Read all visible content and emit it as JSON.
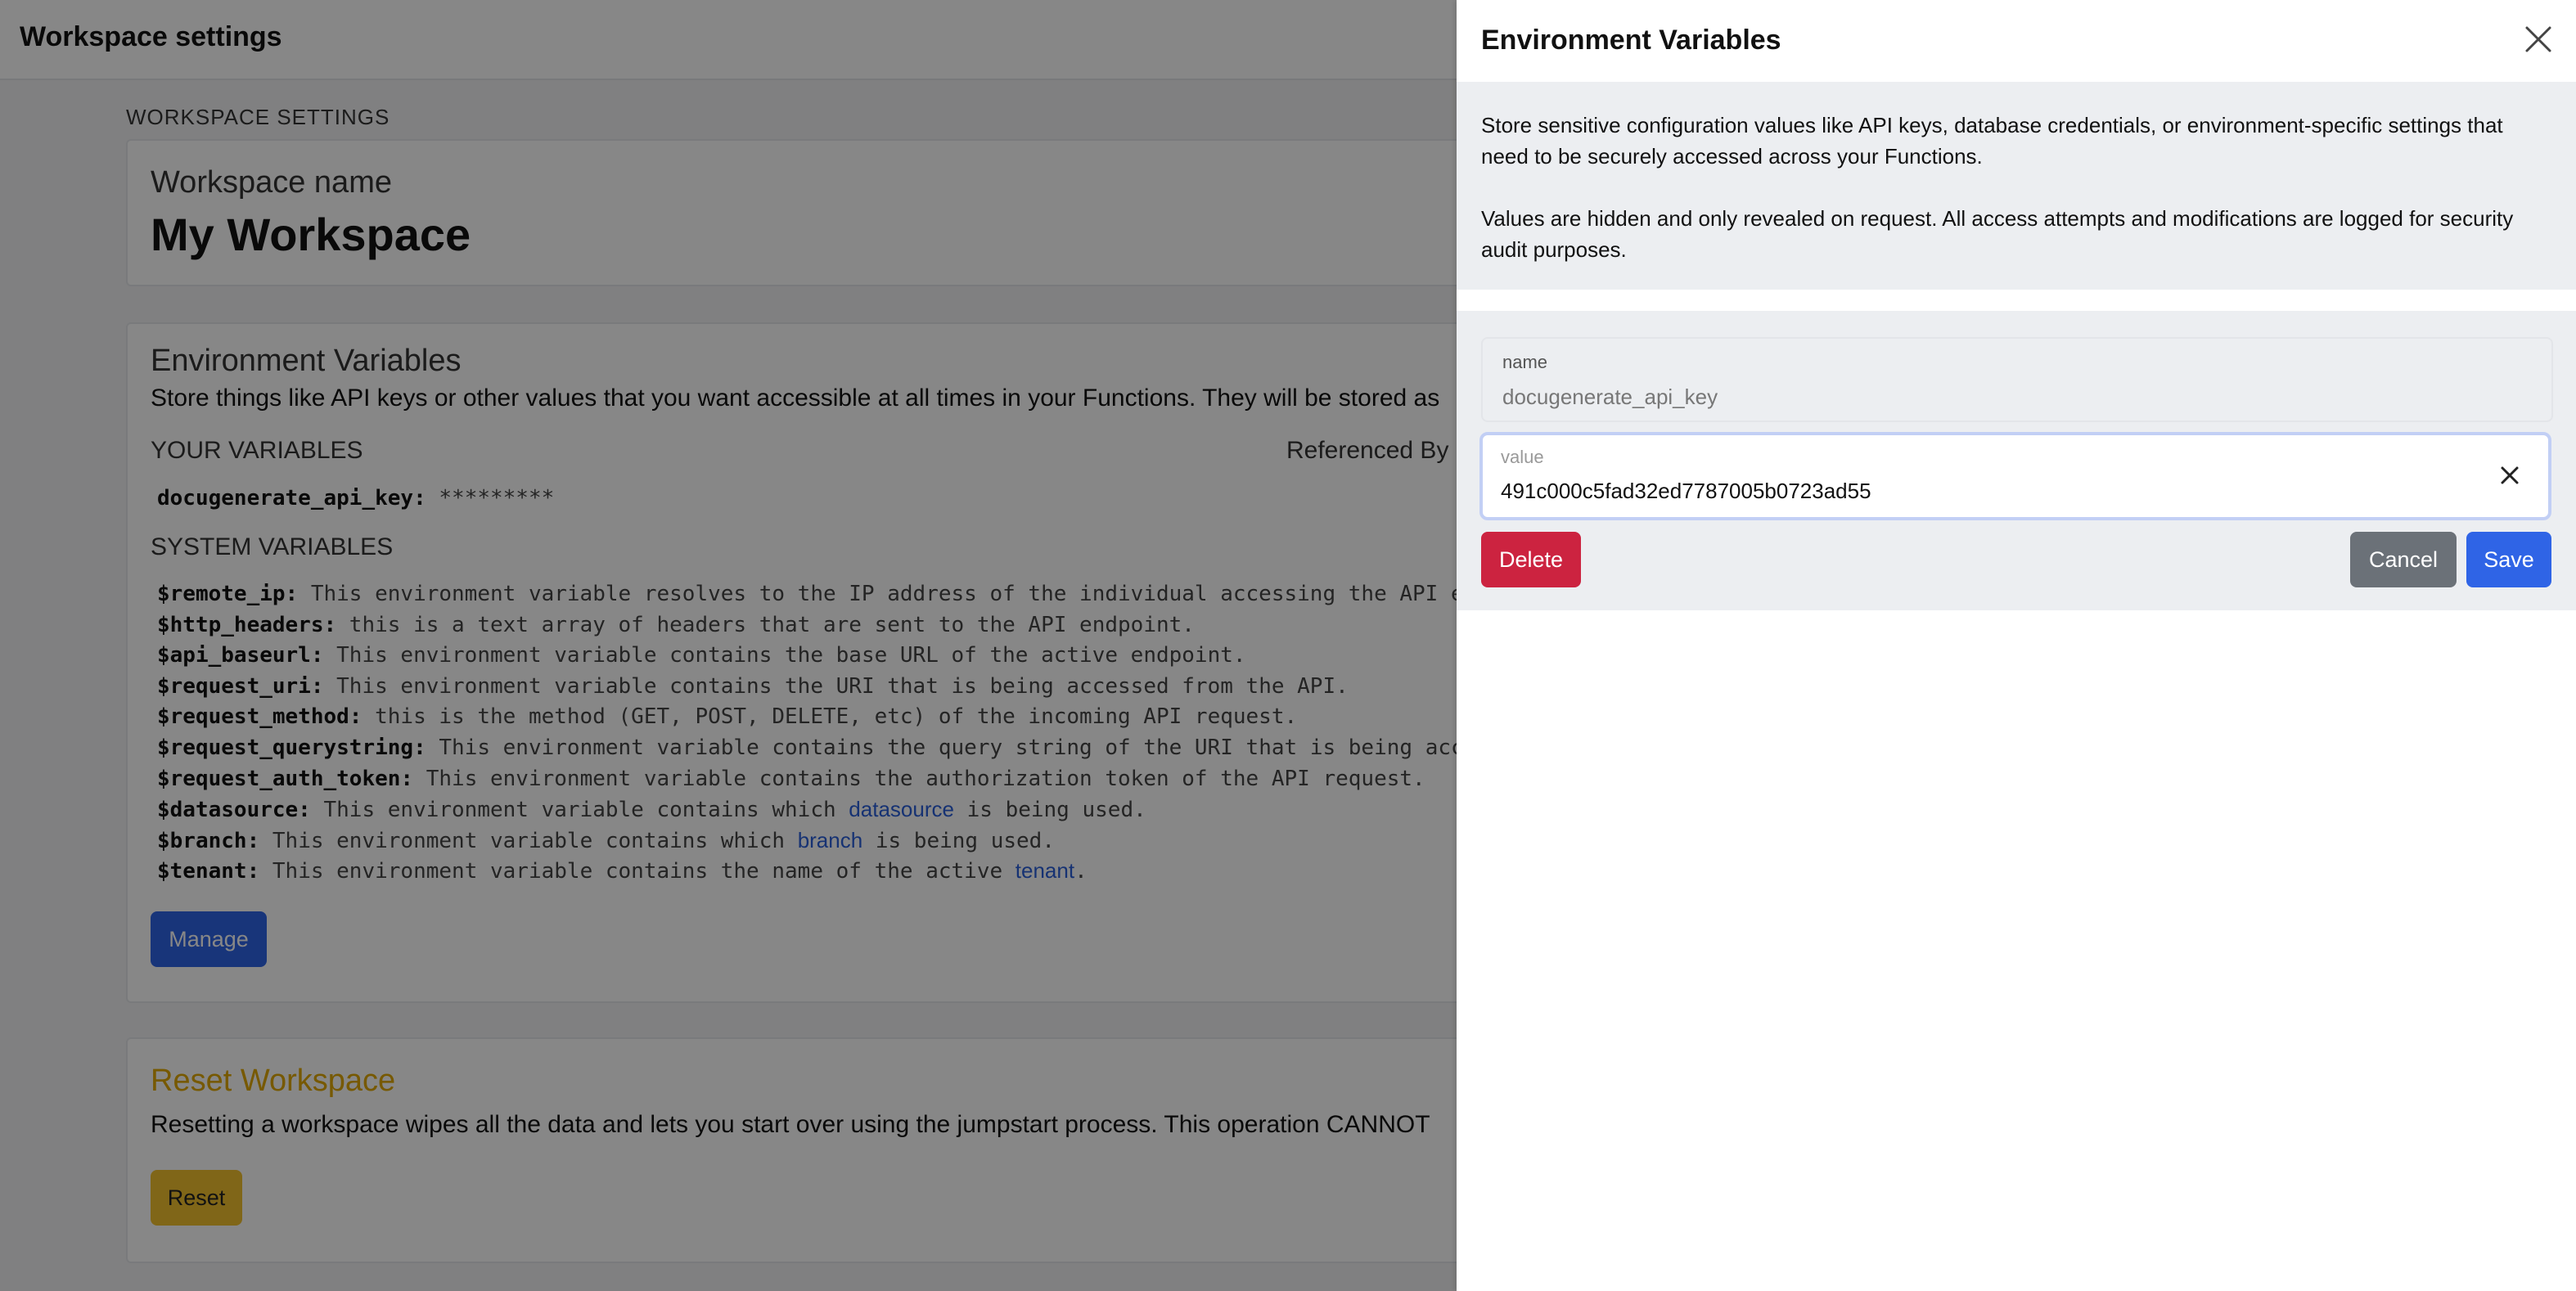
{
  "header": {
    "title": "Workspace settings"
  },
  "main": {
    "section_title": "WORKSPACE SETTINGS",
    "workspace": {
      "label": "Workspace name",
      "value": "My Workspace"
    },
    "env": {
      "title": "Environment Variables",
      "description": "Store things like API keys or other values that you want accessible at all times in your Functions. They will be stored as",
      "your_variables_label": "YOUR VARIABLES",
      "referenced_by_label": "Referenced By",
      "user_variable": {
        "name": "docugenerate_api_key:",
        "value": "*********"
      },
      "system_variables_label": "SYSTEM VARIABLES",
      "system_variables": [
        {
          "name": "$remote_ip:",
          "text": " This environment variable resolves to the IP address of the individual accessing the API endpo"
        },
        {
          "name": "$http_headers:",
          "text": " this is a text array of headers that are sent to the API endpoint."
        },
        {
          "name": "$api_baseurl:",
          "text": " This environment variable contains the base URL of the active endpoint."
        },
        {
          "name": "$request_uri:",
          "text": " This environment variable contains the URI that is being accessed from the API."
        },
        {
          "name": "$request_method:",
          "text": " this is the method (GET, POST, DELETE, etc) of the incoming API request."
        },
        {
          "name": "$request_querystring:",
          "text": " This environment variable contains the query string of the URI that is being access"
        },
        {
          "name": "$request_auth_token:",
          "text": " This environment variable contains the authorization token of the API request."
        },
        {
          "name": "$datasource:",
          "text": " This environment variable contains which ",
          "link": "datasource",
          "after": " is being used."
        },
        {
          "name": "$branch:",
          "text": " This environment variable contains which ",
          "link": "branch",
          "after": " is being used."
        },
        {
          "name": "$tenant:",
          "text": " This environment variable contains the name of the active ",
          "link": "tenant",
          "after": "."
        }
      ],
      "manage_button": "Manage"
    },
    "reset": {
      "title": "Reset Workspace",
      "description": "Resetting a workspace wipes all the data and lets you start over using the jumpstart process. This operation CANNOT",
      "reset_button": "Reset"
    }
  },
  "panel": {
    "title": "Environment Variables",
    "info_1": "Store sensitive configuration values like API keys, database credentials, or environment-specific settings that need to be securely accessed across your Functions.",
    "info_2": "Values are hidden and only revealed on request. All access attempts and modifications are logged for security audit purposes.",
    "name_field": {
      "label": "name",
      "value": "docugenerate_api_key"
    },
    "value_field": {
      "label": "value",
      "value": "491c000c5fad32ed7787005b0723ad55"
    },
    "delete_button": "Delete",
    "cancel_button": "Cancel",
    "save_button": "Save"
  },
  "colors": {
    "primary": "#2f64e6",
    "danger": "#cc2340",
    "secondary": "#6b7178",
    "warning": "#f2c12e",
    "reset_title": "#e0a800"
  },
  "icons": {
    "close": "close-icon",
    "clear": "clear-icon",
    "drag": "drag-handle-icon"
  }
}
